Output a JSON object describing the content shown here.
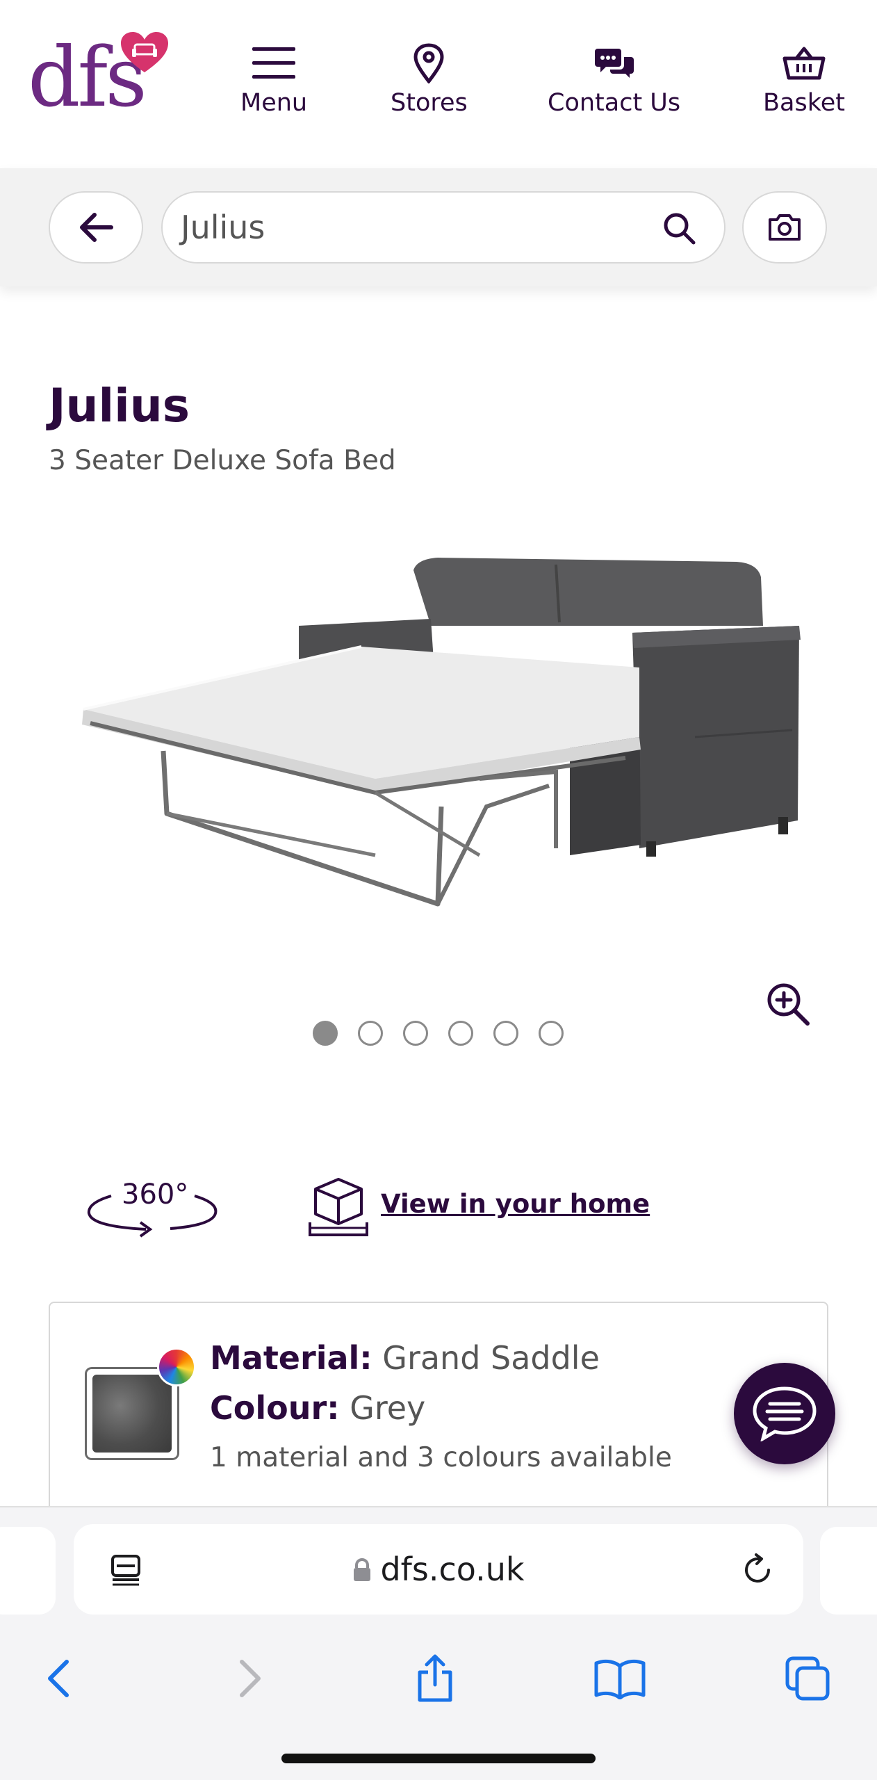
{
  "header": {
    "logo_text": "dfs",
    "nav": [
      {
        "label": "Menu",
        "icon": "menu-icon"
      },
      {
        "label": "Stores",
        "icon": "location-pin-icon"
      },
      {
        "label": "Contact Us",
        "icon": "chat-bubbles-icon"
      },
      {
        "label": "Basket",
        "icon": "basket-icon"
      }
    ]
  },
  "search": {
    "value": "Julius",
    "icons": [
      "back-arrow-icon",
      "search-icon",
      "camera-icon"
    ]
  },
  "product": {
    "title": "Julius",
    "subtitle": "3 Seater Deluxe Sofa Bed",
    "image_count": 6,
    "active_image": 1
  },
  "features": {
    "view360_label": "360°",
    "ar_link": "View in your home"
  },
  "material": {
    "material_label": "Material:",
    "material_value": "Grand Saddle",
    "colour_label": "Colour:",
    "colour_value": "Grey",
    "availability": "1 material and 3 colours available"
  },
  "browser": {
    "url": "dfs.co.uk",
    "icons": [
      "reader-icon",
      "lock-icon",
      "reload-icon",
      "back-icon",
      "forward-icon",
      "share-icon",
      "bookmarks-icon",
      "tabs-icon"
    ]
  },
  "colors": {
    "brand_purple": "#2b0a3d",
    "logo_purple": "#6c2a82",
    "heart_pink": "#c2185b",
    "ios_blue": "#1a73e8"
  }
}
